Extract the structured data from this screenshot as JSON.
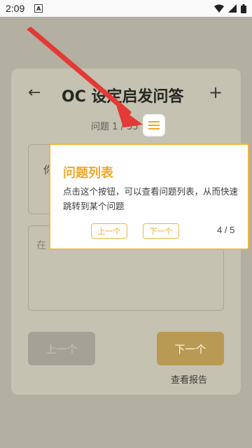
{
  "status_bar": {
    "time": "2:09",
    "notif": "A"
  },
  "header": {
    "back": "←",
    "title": "OC 设定启发问答",
    "add": "+"
  },
  "progress": {
    "text": "问题 1 / 35"
  },
  "question": {
    "text": "你"
  },
  "answer": {
    "placeholder": "在"
  },
  "buttons": {
    "prev": "上一个",
    "next": "下一个",
    "report": "查看报告"
  },
  "tooltip": {
    "title": "问题列表",
    "body": "点击这个按钮，可以查看问题列表，从而快速跳转到某个问题",
    "prev": "上一个",
    "next": "下一个",
    "count": "4 / 5"
  },
  "colors": {
    "accent": "#f0b63d",
    "arrow": "#e53935"
  }
}
